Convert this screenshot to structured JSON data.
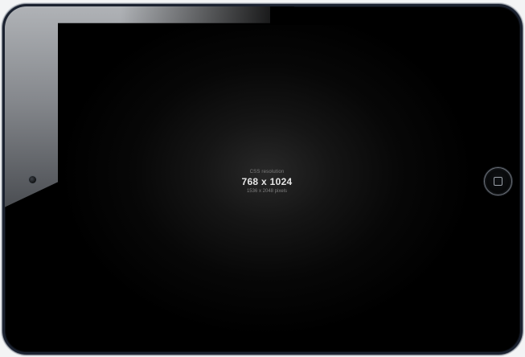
{
  "device": {
    "orientation": "landscape",
    "bezel_color": "#000000",
    "frame_color": "#1b2230",
    "page_background": "#f3f4f5"
  },
  "screen": {
    "css_resolution_label": "CSS resolution",
    "css_resolution_value": "768 x 1024",
    "pixel_resolution_label": "1536 x 2048 pixels"
  },
  "icons": {
    "camera": "camera-icon",
    "home_button": "home-button-square-icon"
  }
}
